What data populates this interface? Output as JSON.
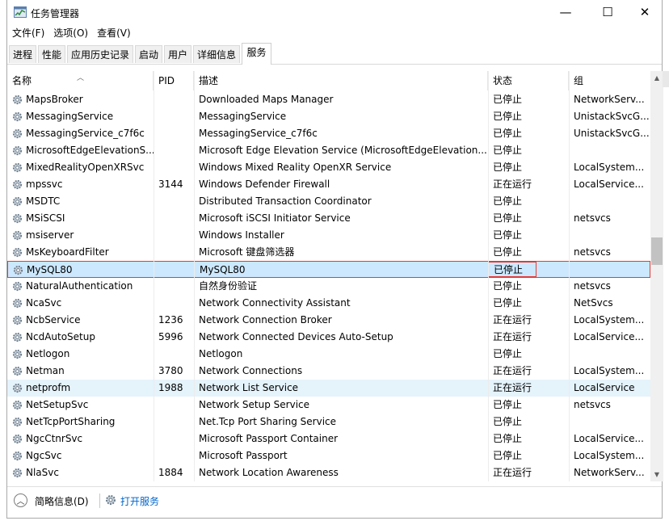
{
  "window": {
    "title": "任务管理器",
    "controls": {
      "minimize": "—",
      "maximize": "☐",
      "close": "✕"
    }
  },
  "menu": [
    "文件(F)",
    "选项(O)",
    "查看(V)"
  ],
  "tabs": [
    {
      "label": "进程",
      "active": false
    },
    {
      "label": "性能",
      "active": false
    },
    {
      "label": "应用历史记录",
      "active": false
    },
    {
      "label": "启动",
      "active": false
    },
    {
      "label": "用户",
      "active": false
    },
    {
      "label": "详细信息",
      "active": false
    },
    {
      "label": "服务",
      "active": true
    }
  ],
  "table": {
    "columns": [
      "名称",
      "PID",
      "描述",
      "状态",
      "组"
    ],
    "rows": [
      {
        "name": "MapsBroker",
        "pid": "",
        "desc": "Downloaded Maps Manager",
        "status": "已停止",
        "group": "NetworkServ..."
      },
      {
        "name": "MessagingService",
        "pid": "",
        "desc": "MessagingService",
        "status": "已停止",
        "group": "UnistackSvcG..."
      },
      {
        "name": "MessagingService_c7f6c",
        "pid": "",
        "desc": "MessagingService_c7f6c",
        "status": "已停止",
        "group": "UnistackSvcG..."
      },
      {
        "name": "MicrosoftEdgeElevationS...",
        "pid": "",
        "desc": "Microsoft Edge Elevation Service (MicrosoftEdgeElevation...",
        "status": "已停止",
        "group": ""
      },
      {
        "name": "MixedRealityOpenXRSvc",
        "pid": "",
        "desc": "Windows Mixed Reality OpenXR Service",
        "status": "已停止",
        "group": "LocalSystem..."
      },
      {
        "name": "mpssvc",
        "pid": "3144",
        "desc": "Windows Defender Firewall",
        "status": "正在运行",
        "group": "LocalService..."
      },
      {
        "name": "MSDTC",
        "pid": "",
        "desc": "Distributed Transaction Coordinator",
        "status": "已停止",
        "group": ""
      },
      {
        "name": "MSiSCSI",
        "pid": "",
        "desc": "Microsoft iSCSI Initiator Service",
        "status": "已停止",
        "group": "netsvcs"
      },
      {
        "name": "msiserver",
        "pid": "",
        "desc": "Windows Installer",
        "status": "已停止",
        "group": ""
      },
      {
        "name": "MsKeyboardFilter",
        "pid": "",
        "desc": "Microsoft 键盘筛选器",
        "status": "已停止",
        "group": "netsvcs"
      },
      {
        "name": "MySQL80",
        "pid": "",
        "desc": "MySQL80",
        "status": "已停止",
        "group": ""
      },
      {
        "name": "NaturalAuthentication",
        "pid": "",
        "desc": "自然身份验证",
        "status": "已停止",
        "group": "netsvcs"
      },
      {
        "name": "NcaSvc",
        "pid": "",
        "desc": "Network Connectivity Assistant",
        "status": "已停止",
        "group": "NetSvcs"
      },
      {
        "name": "NcbService",
        "pid": "1236",
        "desc": "Network Connection Broker",
        "status": "正在运行",
        "group": "LocalSystem..."
      },
      {
        "name": "NcdAutoSetup",
        "pid": "5996",
        "desc": "Network Connected Devices Auto-Setup",
        "status": "正在运行",
        "group": "LocalService..."
      },
      {
        "name": "Netlogon",
        "pid": "",
        "desc": "Netlogon",
        "status": "已停止",
        "group": ""
      },
      {
        "name": "Netman",
        "pid": "3780",
        "desc": "Network Connections",
        "status": "正在运行",
        "group": "LocalSystem..."
      },
      {
        "name": "netprofm",
        "pid": "1988",
        "desc": "Network List Service",
        "status": "正在运行",
        "group": "LocalService"
      },
      {
        "name": "NetSetupSvc",
        "pid": "",
        "desc": "Network Setup Service",
        "status": "已停止",
        "group": "netsvcs"
      },
      {
        "name": "NetTcpPortSharing",
        "pid": "",
        "desc": "Net.Tcp Port Sharing Service",
        "status": "已停止",
        "group": ""
      },
      {
        "name": "NgcCtnrSvc",
        "pid": "",
        "desc": "Microsoft Passport Container",
        "status": "已停止",
        "group": "LocalService..."
      },
      {
        "name": "NgcSvc",
        "pid": "",
        "desc": "Microsoft Passport",
        "status": "已停止",
        "group": "LocalSystem..."
      },
      {
        "name": "NlaSvc",
        "pid": "1884",
        "desc": "Network Location Awareness",
        "status": "正在运行",
        "group": "NetworkServ..."
      }
    ],
    "selected_index": 10,
    "hover_index": 17
  },
  "footer": {
    "brief_label": "简略信息(D)",
    "open_services_label": "打开服务"
  },
  "colors": {
    "hover_row": "#e5f3fb",
    "selected_row": "#cce8ff",
    "highlight_border": "#e53935",
    "link": "#0066cc"
  }
}
